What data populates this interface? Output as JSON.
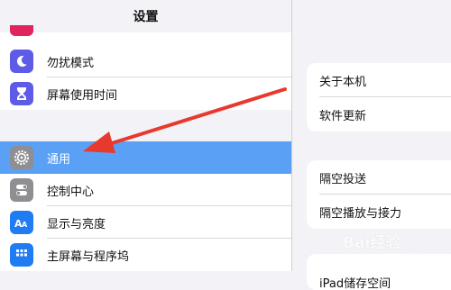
{
  "sidebar": {
    "title": "设置",
    "items": [
      {
        "label": "勿扰模式",
        "icon": "moon-icon",
        "color": "#5e5ce6"
      },
      {
        "label": "屏幕使用时间",
        "icon": "hourglass-icon",
        "color": "#5e5ce6"
      },
      {
        "label": "通用",
        "icon": "gear-icon",
        "color": "#8e8e93",
        "selected": true
      },
      {
        "label": "控制中心",
        "icon": "toggles-icon",
        "color": "#8e8e93"
      },
      {
        "label": "显示与亮度",
        "icon": "text-size-icon",
        "color": "#1f7cf2"
      },
      {
        "label": "主屏幕与程序坞",
        "icon": "home-grid-icon",
        "color": "#1f7cf2"
      }
    ]
  },
  "panel": {
    "group1": [
      "关于本机",
      "软件更新"
    ],
    "group2": [
      "隔空投送",
      "隔空播放与接力"
    ],
    "group3_partial": "iPad储存空间"
  },
  "watermark": {
    "text": "Bai经验",
    "url": "jingyan.baidu.com"
  },
  "colors": {
    "selected_bg": "#5aa0f5",
    "arrow": "#e8392f"
  }
}
